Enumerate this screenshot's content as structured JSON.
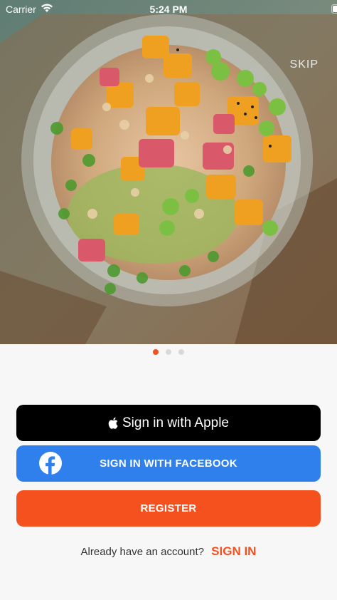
{
  "status_bar": {
    "carrier": "Carrier",
    "time": "5:24 PM"
  },
  "hero": {
    "skip_label": "SKIP"
  },
  "pager": {
    "count": 3,
    "active_index": 0,
    "active_color": "#f4511e",
    "inactive_color": "#d9d9d9"
  },
  "auth": {
    "apple_label": "Sign in with Apple",
    "facebook_label": "SIGN IN WITH FACEBOOK",
    "register_label": "REGISTER",
    "account_prompt": "Already have an account?",
    "signin_link": "SIGN IN"
  },
  "colors": {
    "apple_bg": "#000000",
    "facebook_bg": "#2f80ed",
    "register_bg": "#f4511e",
    "accent": "#f4511e",
    "page_bg": "#f7f7f7"
  },
  "icons": [
    "wifi-icon",
    "battery-icon",
    "apple-icon",
    "facebook-icon"
  ]
}
